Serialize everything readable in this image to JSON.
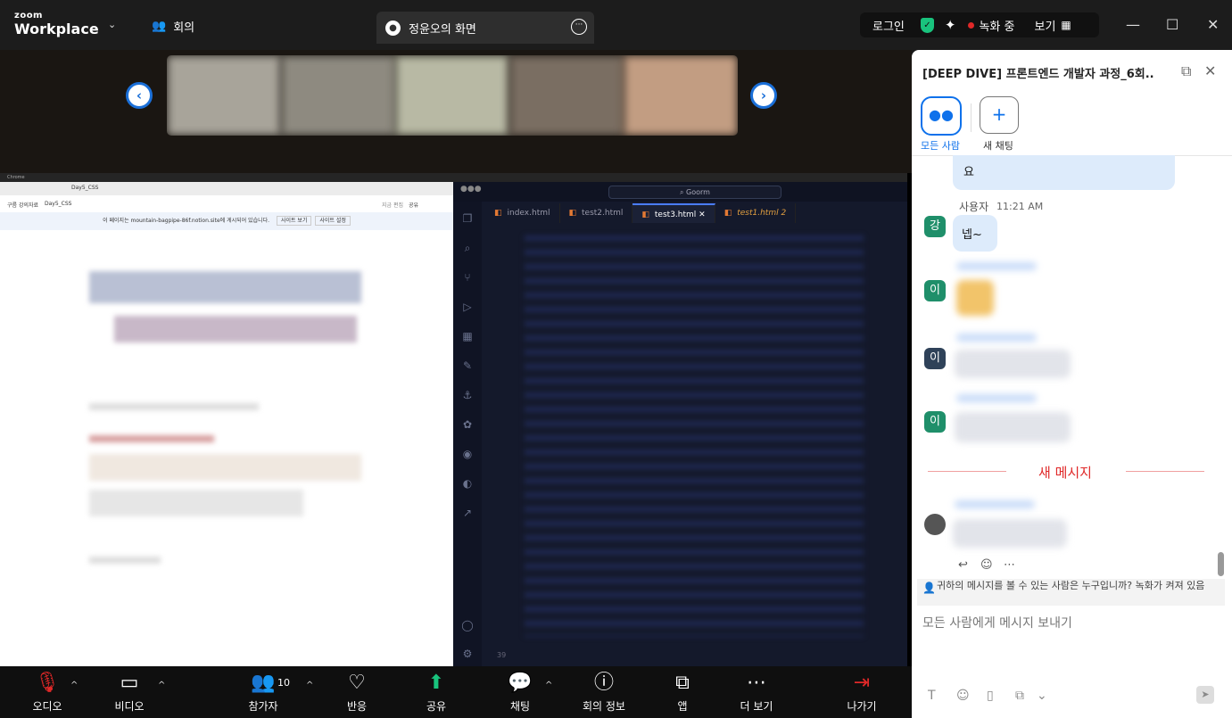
{
  "app": {
    "brand_top": "zoom",
    "brand_bottom": "Workplace"
  },
  "topbar": {
    "meeting_label": "회의",
    "share_tab": "정윤오의 화면",
    "login": "로그인",
    "recording": "녹화 중",
    "view": "보기"
  },
  "shared_screen": {
    "browser": {
      "tab": "Day5_CSS",
      "path_root": "구름 강의자료",
      "path_page": "Day5_CSS",
      "notice": "이 페이지는 mountain-bagpipe-86f.notion.site에 게시되어 있습니다.",
      "btn_view": "사이트 보기",
      "btn_settings": "사이트 설정",
      "edit": "지금 편집",
      "share": "공유"
    },
    "editor": {
      "search": "Goorm",
      "tabs": [
        "index.html",
        "test2.html",
        "test3.html",
        "test1.html"
      ],
      "active_tab": "test3.html",
      "modified_count": "2",
      "line_number": "39"
    }
  },
  "toolbar": {
    "audio": "오디오",
    "video": "비디오",
    "participants": "참가자",
    "participant_count": "10",
    "reactions": "반응",
    "share": "공유",
    "chat": "채팅",
    "meeting_info": "회의 정보",
    "apps": "앱",
    "more": "더 보기",
    "leave": "나가기"
  },
  "chat": {
    "title": "[DEEP DIVE] 프론트엔드 개발자 과정_6회...",
    "everyone": "모든 사람",
    "new_chat": "새 채팅",
    "messages": [
      {
        "text": "요"
      },
      {
        "sender": "사용자",
        "time": "11:21 AM",
        "avatar": "강",
        "text": "넵~"
      }
    ],
    "avatars": [
      "이",
      "이",
      "이"
    ],
    "new_messages": "새 메시지",
    "privacy_notice": "귀하의 메시지를 볼 수 있는 사람은 누구입니까? 녹화가 켜져 있음",
    "composer_placeholder": "모든 사람에게 메시지 보내기"
  },
  "colors": {
    "accent": "#0e71eb",
    "share_green": "#19c37d",
    "record_red": "#e02828",
    "chat_bubble": "#ddebfb",
    "avatar_green": "#1f8f6a",
    "avatar_dark": "#2f4259"
  }
}
